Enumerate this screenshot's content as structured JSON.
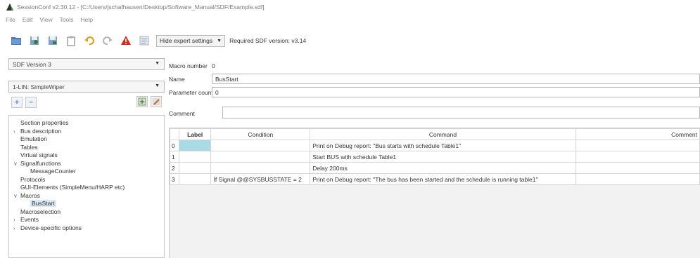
{
  "window": {
    "title": "SessionConf v2.30.12 - [C:/Users/jschafhausen/Desktop/Software_Manual/SDF/Example.sdf]"
  },
  "menu": [
    "File",
    "Edit",
    "View",
    "Tools",
    "Help"
  ],
  "toolbar": {
    "icons": [
      "open-folder-icon",
      "save-icon",
      "save-as-icon",
      "clipboard-icon",
      "undo-icon",
      "redo-icon",
      "warning-icon",
      "list-icon"
    ],
    "expert_combo": "Hide expert settings",
    "required_sdf": "Required SDF version: v3.14"
  },
  "left": {
    "sdf_version": "SDF Version 3",
    "lin_select": "1-LIN: SimpleWiper",
    "tree": [
      {
        "label": "Section properties",
        "indent": 0,
        "expander": ""
      },
      {
        "label": "Bus description",
        "indent": 0,
        "expander": ">"
      },
      {
        "label": "Emulation",
        "indent": 0,
        "expander": ""
      },
      {
        "label": "Tables",
        "indent": 0,
        "expander": ""
      },
      {
        "label": "Virtual signals",
        "indent": 0,
        "expander": ""
      },
      {
        "label": "Signalfunctions",
        "indent": 0,
        "expander": "v"
      },
      {
        "label": "MessageCounter",
        "indent": 1,
        "expander": ""
      },
      {
        "label": "Protocols",
        "indent": 0,
        "expander": ""
      },
      {
        "label": "GUI-Elements (SimpleMenu/HARP etc)",
        "indent": 0,
        "expander": ""
      },
      {
        "label": "Macros",
        "indent": 0,
        "expander": "v"
      },
      {
        "label": "BusStart",
        "indent": 1,
        "expander": "",
        "selected": true
      },
      {
        "label": "Macroselection",
        "indent": 0,
        "expander": ""
      },
      {
        "label": "Events",
        "indent": 0,
        "expander": ">"
      },
      {
        "label": "Device-specific options",
        "indent": 0,
        "expander": ">"
      }
    ]
  },
  "form": {
    "macro_number_label": "Macro number",
    "macro_number_value": "0",
    "name_label": "Name",
    "name_value": "BusStart",
    "param_count_label": "Parameter count",
    "param_count_value": "0",
    "comment_label": "Comment",
    "comment_value": ""
  },
  "grid": {
    "headers": [
      "Label",
      "Condition",
      "Command",
      "Comment"
    ],
    "rows": [
      {
        "num": "0",
        "label": "",
        "condition": "",
        "command": "Print on Debug report: \"Bus starts with schedule Table1\"",
        "comment": ""
      },
      {
        "num": "1",
        "label": "",
        "condition": "",
        "command": "Start BUS with schedule Table1",
        "comment": ""
      },
      {
        "num": "2",
        "label": "",
        "condition": "",
        "command": "Delay 200ms",
        "comment": ""
      },
      {
        "num": "3",
        "label": "",
        "condition": "If Signal @@SYSBUSSTATE = 2",
        "command": "Print on Debug report: \"The bus has been started and the schedule is running table1\"",
        "comment": ""
      }
    ]
  }
}
